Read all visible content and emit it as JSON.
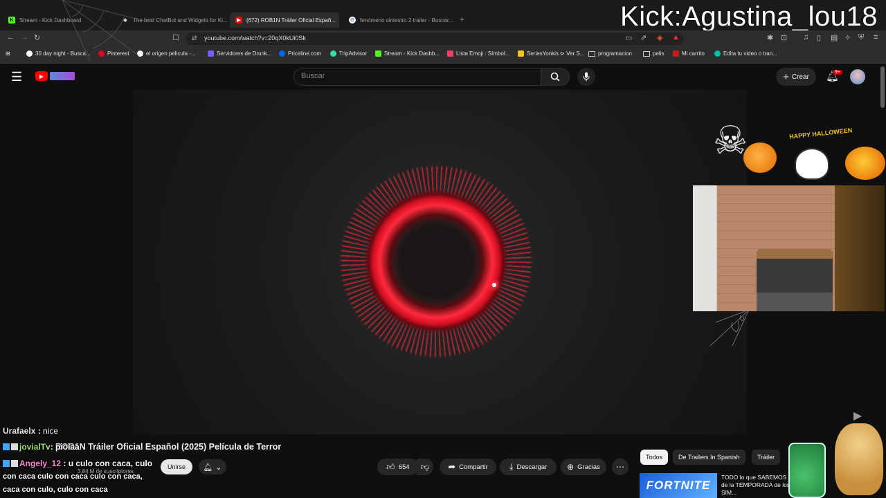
{
  "browser": {
    "tabs": [
      {
        "label": "Stream - Kick Dashboard",
        "fav_color": "#53fc18",
        "fav_text": "K"
      },
      {
        "label": "The best ChatBot and Widgets for Ki...",
        "fav_color": "#cccccc",
        "fav_text": "◆"
      },
      {
        "label": "(672) ROB1N Tráiler Oficial Españ...",
        "fav_color": "#ff0000",
        "fav_text": "▶",
        "active": true
      },
      {
        "label": "fenómeno siniestro 2 trailer - Buscar...",
        "fav_color": "#4285f4",
        "fav_text": "G"
      }
    ],
    "new_tab": "+",
    "url": "youtube.com/watch?v=20qX0kUi0Sk",
    "bookmarks": [
      {
        "label": "30 day night - Busca...",
        "color": "#4285f4"
      },
      {
        "label": "Pinterest",
        "color": "#e60023"
      },
      {
        "label": "el origen pelicula -...",
        "color": "#4285f4"
      },
      {
        "label": "Servidores de Drunk...",
        "color": "#7a5cff"
      },
      {
        "label": "Priceline.com",
        "color": "#0068ef"
      },
      {
        "label": "TripAdvisor",
        "color": "#34e0a1"
      },
      {
        "label": "Stream - Kick Dashb...",
        "color": "#53fc18"
      },
      {
        "label": "Lista Emoji : Símbol...",
        "color": "#ff3b6b"
      },
      {
        "label": "SeriesYonkis ⊳ Ver S...",
        "color": "#f5c518"
      },
      {
        "label": "programacion",
        "color": "folder"
      },
      {
        "label": "pelis",
        "color": "folder"
      },
      {
        "label": "Mi carrito",
        "color": "#c71a1a"
      },
      {
        "label": "Edita tu video o tran...",
        "color": "#00c4a7"
      }
    ]
  },
  "stream_overlay": {
    "name": "Kick:Agustina_lou18",
    "halloween_text": "HAPPY HALLOWEEN"
  },
  "youtube": {
    "search_placeholder": "Buscar",
    "create_label": "Crear",
    "notif_badge": "9+",
    "video_title": "ROB1N Tráiler Oficial Español (2025) Película de Terror",
    "subscribers": "3.84 M de suscriptores",
    "join_label": "Unirse",
    "likes": "654",
    "share_label": "Compartir",
    "download_label": "Descargar",
    "thanks_label": "Gracias",
    "chips": [
      "Todos",
      "De Trailers In Spanish",
      "Tráiler"
    ],
    "rec_thumb_text": "FORTNITE",
    "rec_title": "TODO lo que SABEMOS de la TEMPORADA de los SIM..."
  },
  "chat": [
    {
      "user": "Urafaelx",
      "msg": "nice",
      "badges": false,
      "plain": true
    },
    {
      "user": "jovialTv",
      "msg": "piolaa",
      "badges": true
    },
    {
      "user": "Angely_12",
      "msg": "u culo con caca, culo",
      "badges": true
    },
    {
      "user": "",
      "msg": "con caca culo con caca culo con caca,",
      "badges": false
    },
    {
      "user": "",
      "msg": "caca con culo, culo con caca",
      "badges": false
    }
  ],
  "colors": {
    "accent": "#ff0000",
    "chat_user": "#9be26b",
    "ring": "#ff2a3c"
  }
}
